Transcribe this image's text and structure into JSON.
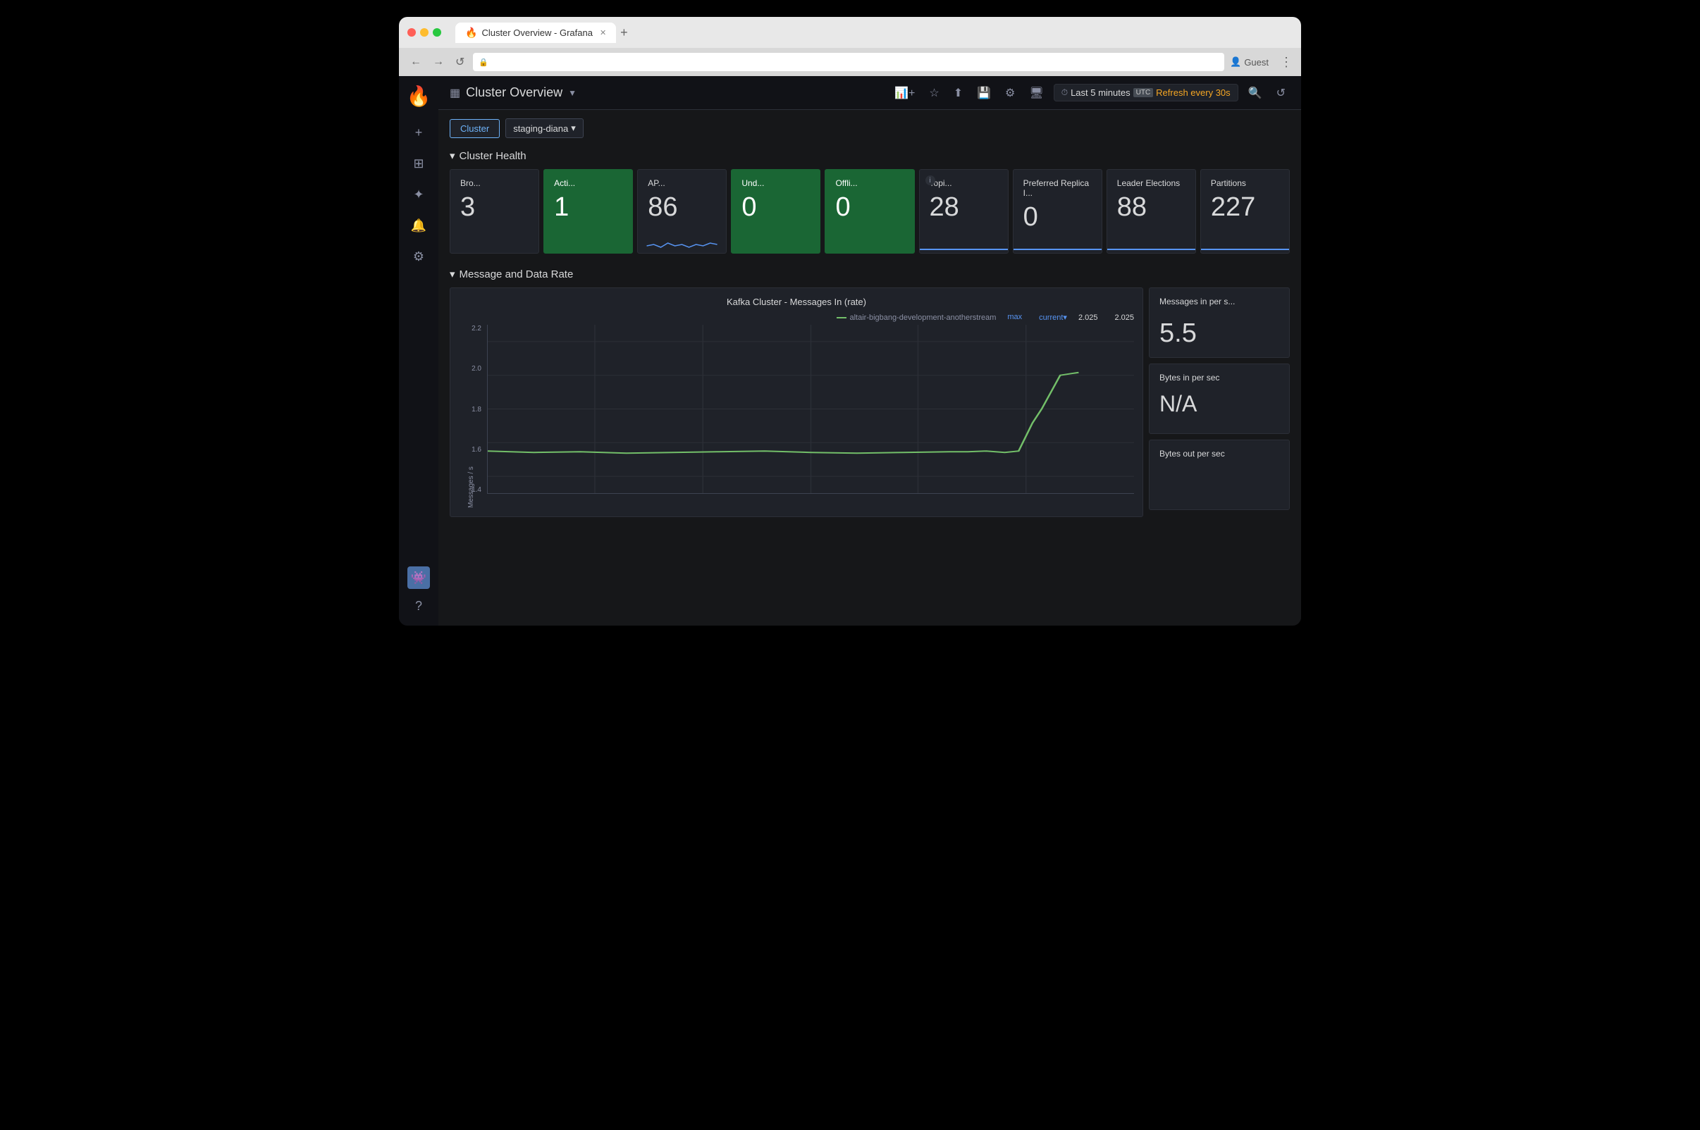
{
  "browser": {
    "tab_title": "Cluster Overview - Grafana",
    "address": "",
    "nav": {
      "back": "←",
      "forward": "→",
      "reload": "↺",
      "menu": "⋮"
    },
    "guest_label": "Guest",
    "tab_new": "+"
  },
  "grafana": {
    "logo": "🔥",
    "sidebar": {
      "plus_icon": "+",
      "grid_icon": "⊞",
      "compass_icon": "✦",
      "bell_icon": "🔔",
      "gear_icon": "⚙",
      "help_icon": "?",
      "avatar_icon": "👾"
    },
    "topbar": {
      "grid_icon": "▦",
      "dashboard_title": "Cluster Overview",
      "dropdown_arrow": "▼",
      "add_panel_icon": "📊",
      "star_icon": "☆",
      "share_icon": "⬆",
      "save_icon": "💾",
      "settings_icon": "⚙",
      "tv_icon": "🖥",
      "clock_icon": "⏱",
      "time_range": "Last 5 minutes",
      "utc_label": "UTC",
      "refresh_label": "Refresh every 30s",
      "search_icon": "🔍",
      "sync_icon": "↺"
    },
    "filters": {
      "cluster_label": "Cluster",
      "cluster_value": "staging-diana",
      "dropdown_arrow": "▾"
    },
    "cluster_health": {
      "section_title": "Cluster Health",
      "collapse_icon": "▾",
      "cards": [
        {
          "id": "brokers",
          "title": "Bro...",
          "value": "3",
          "green": false,
          "has_sparkline": false
        },
        {
          "id": "active-controllers",
          "title": "Acti...",
          "value": "1",
          "green": true,
          "has_sparkline": false
        },
        {
          "id": "api",
          "title": "AP...",
          "value": "86",
          "green": false,
          "has_sparkline": true
        },
        {
          "id": "under-replicated",
          "title": "Und...",
          "value": "0",
          "green": true,
          "has_sparkline": false
        },
        {
          "id": "offline",
          "title": "Offli...",
          "value": "0",
          "green": true,
          "has_sparkline": false
        },
        {
          "id": "topics",
          "title": "Topi...",
          "value": "28",
          "green": false,
          "has_sparkline": true,
          "has_info": true
        },
        {
          "id": "preferred-replica",
          "title": "Preferred Replica I...",
          "value": "0",
          "green": false,
          "has_sparkline": true
        },
        {
          "id": "leader-elections",
          "title": "Leader Elections",
          "value": "88",
          "green": false,
          "has_sparkline": true
        },
        {
          "id": "partitions",
          "title": "Partitions",
          "value": "227",
          "green": false,
          "has_sparkline": true
        }
      ]
    },
    "message_data_rate": {
      "section_title": "Message and Data Rate",
      "collapse_icon": "▾",
      "chart": {
        "title": "Kafka Cluster - Messages In (rate)",
        "x_axis_label": "Messages / s",
        "y_labels": [
          "2.2",
          "2.0",
          "1.8",
          "1.6",
          "1.4"
        ],
        "legend_stream": "altair-bigbang-development-anotherstream",
        "legend_max_label": "max",
        "legend_current_label": "current▾",
        "legend_max_value": "2.025",
        "legend_current_value": "2.025"
      },
      "side_metrics": [
        {
          "id": "messages-in",
          "title": "Messages in per s...",
          "value": "5.5"
        },
        {
          "id": "bytes-in",
          "title": "Bytes in per sec",
          "value": "N/A"
        },
        {
          "id": "bytes-out",
          "title": "Bytes out per sec",
          "value": ""
        }
      ]
    }
  }
}
